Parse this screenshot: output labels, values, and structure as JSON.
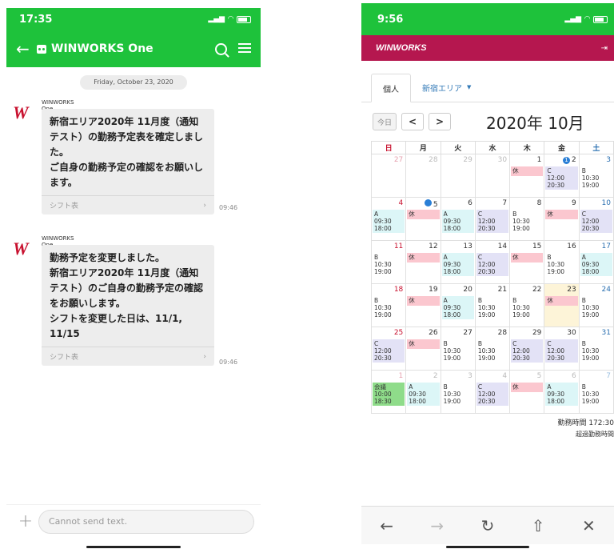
{
  "left": {
    "status_time": "17:35",
    "header_title": "WINWORKS One",
    "date_pill": "Friday, October 23, 2020",
    "messages": [
      {
        "sender": "WINWORKS One",
        "text": "新宿エリア2020年 11月度（通知テスト）の勤務予定表を確定しました。\nご自身の勤務予定の確認をお願いします。",
        "link": "シフト表",
        "time": "09:46"
      },
      {
        "sender": "WINWORKS One",
        "text": "勤務予定を変更しました。\n新宿エリア2020年 11月度（通知テスト）のご自身の勤務予定の確認をお願いします。\nシフトを変更した日は、11/1, 11/15",
        "link": "シフト表",
        "time": "09:46"
      }
    ],
    "input_placeholder": "Cannot send text."
  },
  "right": {
    "status_time": "9:56",
    "brand": "WINWORKS",
    "tab_personal": "個人",
    "tab_area": "新宿エリア",
    "today_button": "今日",
    "prev_button": "<",
    "next_button": ">",
    "calendar_title": "2020年 10月",
    "weekdays": [
      "日",
      "月",
      "火",
      "水",
      "木",
      "金",
      "土"
    ],
    "weeks": [
      [
        {
          "d": "27",
          "other": true
        },
        {
          "d": "28",
          "other": true
        },
        {
          "d": "29",
          "other": true
        },
        {
          "d": "30",
          "other": true
        },
        {
          "d": "1",
          "shift": "休",
          "type": "kyu"
        },
        {
          "d": "2",
          "badge": "1",
          "shift": "C",
          "t1": "12:00",
          "t2": "20:30",
          "type": "C"
        },
        {
          "d": "3",
          "shift": "B",
          "t1": "10:30",
          "t2": "19:00",
          "type": "B"
        }
      ],
      [
        {
          "d": "4",
          "shift": "A",
          "t1": "09:30",
          "t2": "18:00",
          "type": "A"
        },
        {
          "d": "5",
          "badge": " ",
          "shift": "休",
          "type": "kyu"
        },
        {
          "d": "6",
          "shift": "A",
          "t1": "09:30",
          "t2": "18:00",
          "type": "A"
        },
        {
          "d": "7",
          "shift": "C",
          "t1": "12:00",
          "t2": "20:30",
          "type": "C"
        },
        {
          "d": "8",
          "shift": "B",
          "t1": "10:30",
          "t2": "19:00",
          "type": "B"
        },
        {
          "d": "9",
          "shift": "休",
          "type": "kyu"
        },
        {
          "d": "10",
          "shift": "C",
          "t1": "12:00",
          "t2": "20:30",
          "type": "C"
        }
      ],
      [
        {
          "d": "11",
          "shift": "B",
          "t1": "10:30",
          "t2": "19:00",
          "type": "B"
        },
        {
          "d": "12",
          "shift": "休",
          "type": "kyu"
        },
        {
          "d": "13",
          "shift": "A",
          "t1": "09:30",
          "t2": "18:00",
          "type": "A"
        },
        {
          "d": "14",
          "shift": "C",
          "t1": "12:00",
          "t2": "20:30",
          "type": "C"
        },
        {
          "d": "15",
          "shift": "休",
          "type": "kyu"
        },
        {
          "d": "16",
          "shift": "B",
          "t1": "10:30",
          "t2": "19:00",
          "type": "B"
        },
        {
          "d": "17",
          "shift": "A",
          "t1": "09:30",
          "t2": "18:00",
          "type": "A"
        }
      ],
      [
        {
          "d": "18",
          "shift": "B",
          "t1": "10:30",
          "t2": "19:00",
          "type": "B"
        },
        {
          "d": "19",
          "shift": "休",
          "type": "kyu"
        },
        {
          "d": "20",
          "shift": "A",
          "t1": "09:30",
          "t2": "18:00",
          "type": "A"
        },
        {
          "d": "21",
          "shift": "B",
          "t1": "10:30",
          "t2": "19:00",
          "type": "B"
        },
        {
          "d": "22",
          "shift": "B",
          "t1": "10:30",
          "t2": "19:00",
          "type": "B"
        },
        {
          "d": "23",
          "today": true,
          "shift": "休",
          "type": "kyu"
        },
        {
          "d": "24",
          "shift": "B",
          "t1": "10:30",
          "t2": "19:00",
          "type": "B"
        }
      ],
      [
        {
          "d": "25",
          "shift": "C",
          "t1": "12:00",
          "t2": "20:30",
          "type": "C"
        },
        {
          "d": "26",
          "shift": "休",
          "type": "kyu"
        },
        {
          "d": "27",
          "shift": "B",
          "t1": "10:30",
          "t2": "19:00",
          "type": "B"
        },
        {
          "d": "28",
          "shift": "B",
          "t1": "10:30",
          "t2": "19:00",
          "type": "B"
        },
        {
          "d": "29",
          "shift": "C",
          "t1": "12:00",
          "t2": "20:30",
          "type": "C"
        },
        {
          "d": "30",
          "shift": "C",
          "t1": "12:00",
          "t2": "20:30",
          "type": "C"
        },
        {
          "d": "31",
          "shift": "B",
          "t1": "10:30",
          "t2": "19:00",
          "type": "B"
        }
      ],
      [
        {
          "d": "1",
          "other": true,
          "shift": "会議",
          "t1": "10:00",
          "t2": "18:30",
          "type": "kaigi"
        },
        {
          "d": "2",
          "other": true,
          "shift": "A",
          "t1": "09:30",
          "t2": "18:00",
          "type": "A"
        },
        {
          "d": "3",
          "other": true,
          "shift": "B",
          "t1": "10:30",
          "t2": "19:00",
          "type": "B"
        },
        {
          "d": "4",
          "other": true,
          "shift": "C",
          "t1": "12:00",
          "t2": "20:30",
          "type": "C"
        },
        {
          "d": "5",
          "other": true,
          "shift": "休",
          "type": "kyu"
        },
        {
          "d": "6",
          "other": true,
          "shift": "A",
          "t1": "09:30",
          "t2": "18:00",
          "type": "A"
        },
        {
          "d": "7",
          "other": true,
          "shift": "B",
          "t1": "10:30",
          "t2": "19:00",
          "type": "B"
        }
      ]
    ],
    "summary_work": "勤務時間 172:30",
    "summary_overtime": "超過勤務時間",
    "colors": {
      "green": "#1ec23b",
      "brand": "#b5174f",
      "kyu": "#fbc7cf",
      "A": "#dcf6f7",
      "C": "#e3e2f6",
      "kaigi": "#8fdc8a"
    }
  }
}
